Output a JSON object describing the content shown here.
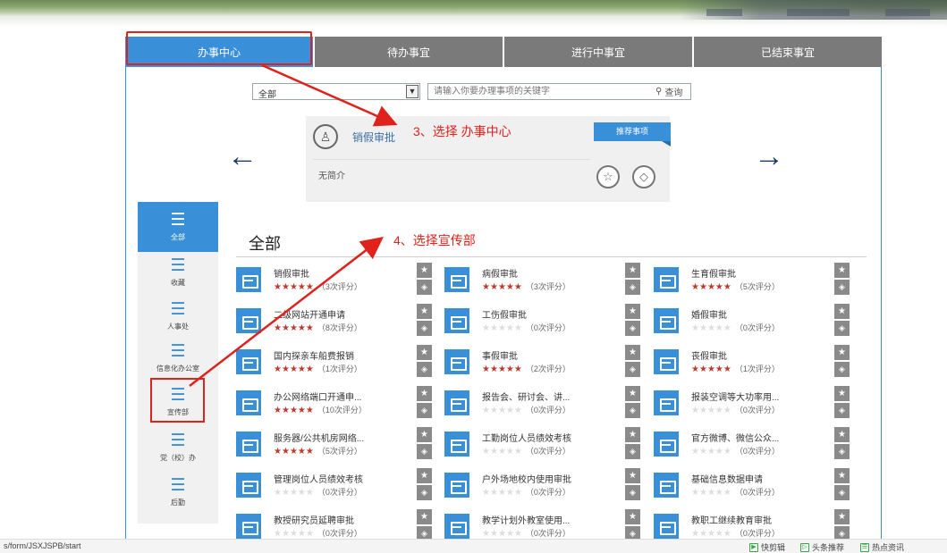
{
  "tabs": [
    {
      "label": "办事中心"
    },
    {
      "label": "待办事宜"
    },
    {
      "label": "进行中事宜"
    },
    {
      "label": "已结束事宜"
    }
  ],
  "search": {
    "category_value": "全部",
    "placeholder": "请输入你要办理事项的关键字",
    "button_label": "查询"
  },
  "featured": {
    "title": "销假审批",
    "description": "无简介",
    "badge": "推荐事项"
  },
  "annotations": {
    "step3": "3、选择 办事中心",
    "step4": "4、选择宣传部"
  },
  "sidebar": {
    "items": [
      {
        "label": "全部"
      },
      {
        "label": "收藏"
      },
      {
        "label": "人事处"
      },
      {
        "label": "信息化办公室"
      },
      {
        "label": "宣传部"
      },
      {
        "label": "党（校）办"
      },
      {
        "label": "后勤"
      }
    ]
  },
  "section_title": "全部",
  "services": [
    {
      "name": "销假审批",
      "rating": 5,
      "count": "（3次评分）"
    },
    {
      "name": "病假审批",
      "rating": 4.5,
      "count": "（3次评分）"
    },
    {
      "name": "生育假审批",
      "rating": 5,
      "count": "（5次评分）"
    },
    {
      "name": "二级网站开通申请",
      "rating": 5,
      "count": "（8次评分）"
    },
    {
      "name": "工伤假审批",
      "rating": 0,
      "count": "（0次评分）"
    },
    {
      "name": "婚假审批",
      "rating": 0,
      "count": "（0次评分）"
    },
    {
      "name": "国内探亲车船费报销",
      "rating": 5,
      "count": "（1次评分）"
    },
    {
      "name": "事假审批",
      "rating": 5,
      "count": "（2次评分）"
    },
    {
      "name": "丧假审批",
      "rating": 5,
      "count": "（1次评分）"
    },
    {
      "name": "办公网络端口开通申...",
      "rating": 5,
      "count": "（10次评分）"
    },
    {
      "name": "报告会、研讨会、讲...",
      "rating": 0,
      "count": "（0次评分）"
    },
    {
      "name": "报装空调等大功率用...",
      "rating": 0,
      "count": "（0次评分）"
    },
    {
      "name": "服务器/公共机房网络...",
      "rating": 5,
      "count": "（5次评分）"
    },
    {
      "name": "工勤岗位人员绩效考核",
      "rating": 0,
      "count": "（0次评分）"
    },
    {
      "name": "官方微博、微信公众...",
      "rating": 0,
      "count": "（0次评分）"
    },
    {
      "name": "管理岗位人员绩效考核",
      "rating": 0,
      "count": "（0次评分）"
    },
    {
      "name": "户外场地校内使用审批",
      "rating": 0,
      "count": "（0次评分）"
    },
    {
      "name": "基础信息数据申请",
      "rating": 0,
      "count": "（0次评分）"
    },
    {
      "name": "教授研究员延聘审批",
      "rating": 0,
      "count": "（0次评分）"
    },
    {
      "name": "教学计划外教室使用...",
      "rating": 0,
      "count": "（0次评分）"
    },
    {
      "name": "教职工继续教育审批",
      "rating": 0,
      "count": "（0次评分）"
    }
  ],
  "statusbar": {
    "url": "s/form/JSXJSPB/start",
    "items": [
      {
        "label": "快剪辑"
      },
      {
        "label": "头条推荐"
      },
      {
        "label": "热点资讯"
      }
    ]
  },
  "colors": {
    "accent": "#3a8fd9",
    "tab_inactive": "#7a7a7a",
    "highlight": "#e0221c",
    "star": "#c0392b"
  }
}
